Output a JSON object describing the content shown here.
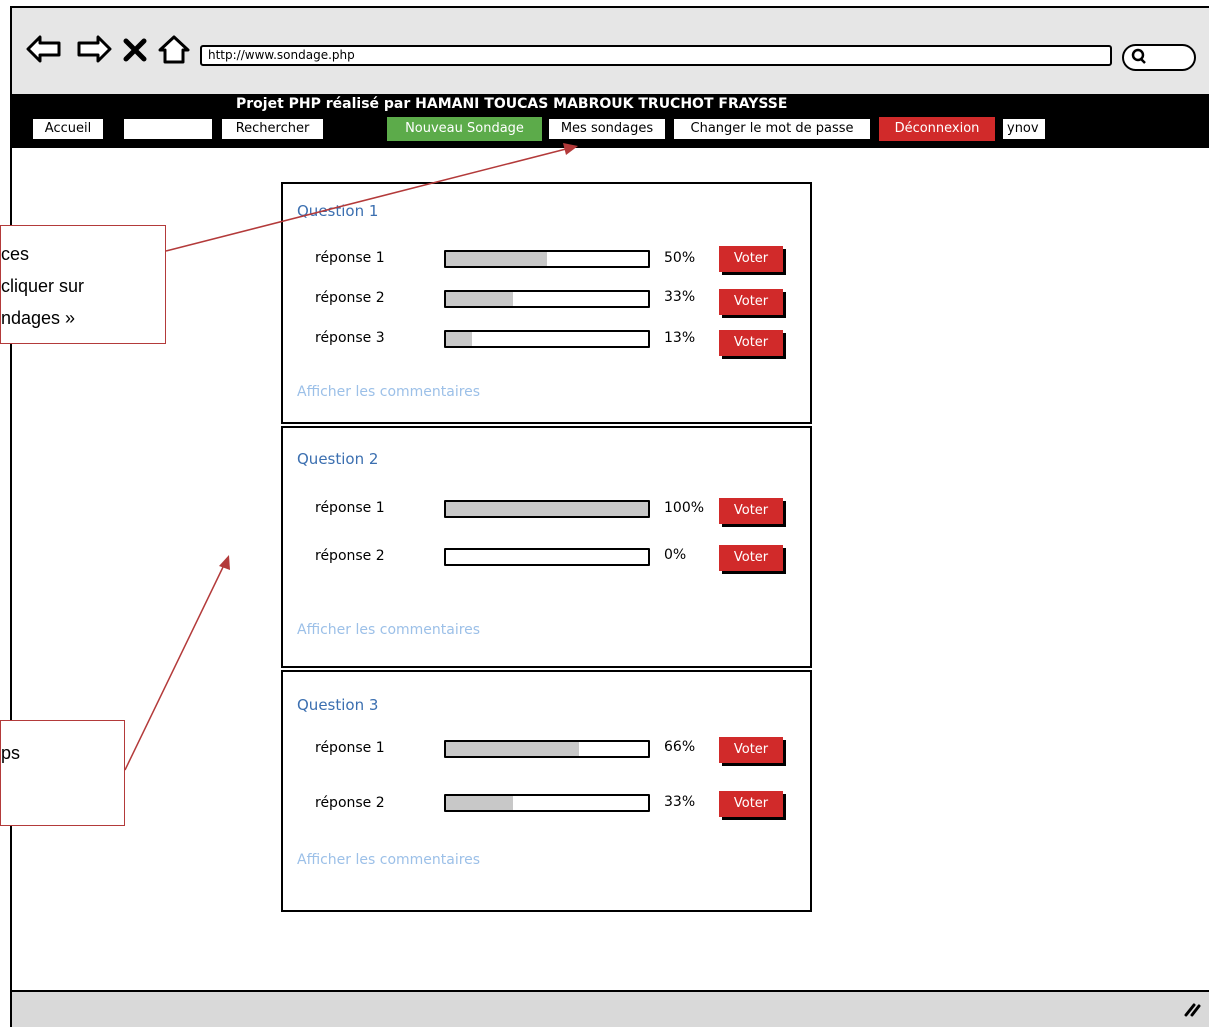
{
  "browser": {
    "url": "http://www.sondage.php",
    "nav": {
      "back_icon": "back-arrow-icon",
      "forward_icon": "forward-arrow-icon",
      "stop_icon": "close-icon",
      "home_icon": "home-icon"
    },
    "search_icon": "search-icon"
  },
  "header": {
    "title": "Projet PHP réalisé par HAMANI TOUCAS MABROUK TRUCHOT FRAYSSE",
    "accueil": "Accueil",
    "search_value": "",
    "rechercher": "Rechercher",
    "nouveau_sondage": "Nouveau Sondage",
    "mes_sondages": "Mes sondages",
    "changer_mdp": "Changer le mot de passe",
    "deconnexion": "Déconnexion",
    "user": "ynov"
  },
  "colors": {
    "green": "#5cab4a",
    "red": "#d12a2a",
    "link": "#9cc0e8",
    "title": "#3b6fb0"
  },
  "questions": [
    {
      "title": "Question 1",
      "answers": [
        {
          "label": "réponse 1",
          "percent": 50,
          "percent_text": "50%",
          "vote": "Voter"
        },
        {
          "label": "réponse 2",
          "percent": 33,
          "percent_text": "33%",
          "vote": "Voter"
        },
        {
          "label": "réponse 3",
          "percent": 13,
          "percent_text": "13%",
          "vote": "Voter"
        }
      ],
      "comments": "Afficher les commentaires"
    },
    {
      "title": "Question 2",
      "answers": [
        {
          "label": "réponse 1",
          "percent": 100,
          "percent_text": "100%",
          "vote": "Voter"
        },
        {
          "label": "réponse 2",
          "percent": 0,
          "percent_text": "0%",
          "vote": "Voter"
        }
      ],
      "comments": "Afficher les commentaires"
    },
    {
      "title": "Question 3",
      "answers": [
        {
          "label": "réponse 1",
          "percent": 66,
          "percent_text": "66%",
          "vote": "Voter"
        },
        {
          "label": "réponse 2",
          "percent": 33,
          "percent_text": "33%",
          "vote": "Voter"
        }
      ],
      "comments": "Afficher les commentaires"
    }
  ],
  "annotations": {
    "note1": [
      "ces",
      " cliquer sur",
      "ndages »"
    ],
    "note2": [
      "ps"
    ]
  }
}
